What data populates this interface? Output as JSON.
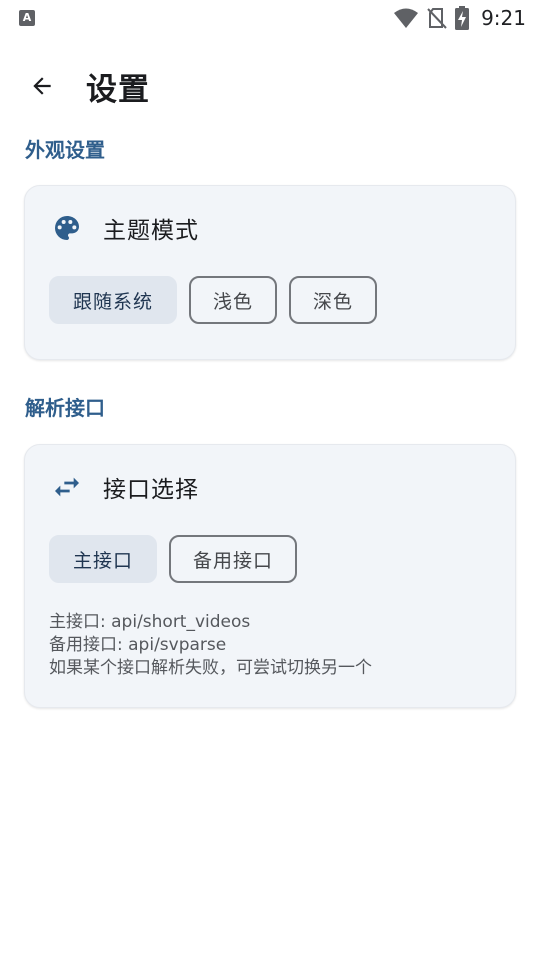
{
  "status_bar": {
    "time": "9:21",
    "left_icon_letter": "A"
  },
  "app_bar": {
    "title": "设置"
  },
  "appearance": {
    "section_title": "外观设置",
    "card_title": "主题模式",
    "options": [
      {
        "label": "跟随系统",
        "selected": true
      },
      {
        "label": "浅色",
        "selected": false
      },
      {
        "label": "深色",
        "selected": false
      }
    ]
  },
  "parse_api": {
    "section_title": "解析接口",
    "card_title": "接口选择",
    "options": [
      {
        "label": "主接口",
        "selected": true
      },
      {
        "label": "备用接口",
        "selected": false
      }
    ],
    "info": [
      "主接口: api/short_videos",
      "备用接口: api/svparse",
      "如果某个接口解析失败，可尝试切换另一个"
    ]
  },
  "colors": {
    "accent": "#2f5e8c",
    "card_bg": "#f2f5f9",
    "chip_selected_bg": "#e0e6ee"
  }
}
